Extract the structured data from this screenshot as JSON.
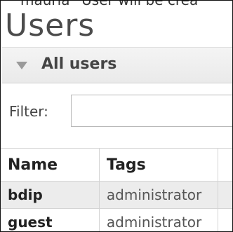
{
  "cut_text": "mauria “User will be crea",
  "page_title": "Users",
  "section": {
    "label": "All users"
  },
  "filter": {
    "label": "Filter:",
    "value": ""
  },
  "table": {
    "headers": [
      "Name",
      "Tags"
    ],
    "rows": [
      {
        "name": "bdip",
        "tags": "administrator"
      },
      {
        "name": "guest",
        "tags": "administrator"
      }
    ]
  }
}
